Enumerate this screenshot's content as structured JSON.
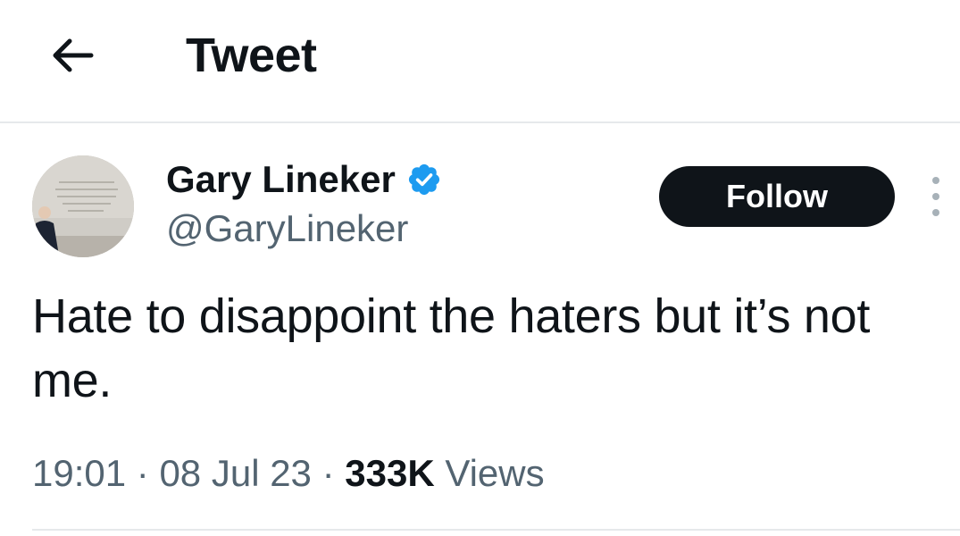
{
  "header": {
    "back_icon": "arrow-left-icon",
    "title": "Tweet"
  },
  "tweet": {
    "author": {
      "name": "Gary Lineker",
      "handle": "@GaryLineker",
      "verified": true,
      "verified_color": "#1d9bf0"
    },
    "follow_label": "Follow",
    "more_icon": "vertical-ellipsis-icon",
    "text": "Hate to disappoint the haters but it’s not me.",
    "time": "19:01",
    "separator": "·",
    "date": "08 Jul 23",
    "views_count": "333K",
    "views_label": "Views"
  },
  "colors": {
    "text_primary": "#0f1419",
    "text_secondary": "#536471",
    "follow_bg": "#0f1419",
    "divider": "#e6e9eb"
  }
}
